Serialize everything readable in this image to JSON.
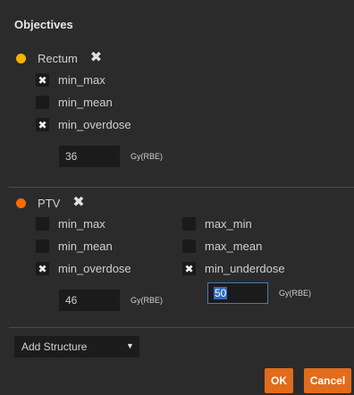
{
  "title": "Objectives",
  "colors": {
    "rectum_dot": "#f5b400",
    "ptv_dot": "#ff6a00",
    "button": "#e06c1c",
    "checkmark": "✖"
  },
  "structures": [
    {
      "name": "Rectum",
      "objectives": [
        {
          "label": "min_max",
          "checked": true
        },
        {
          "label": "min_mean",
          "checked": false
        },
        {
          "label": "min_overdose",
          "checked": true
        }
      ],
      "dose": {
        "value": "36",
        "unit": "Gy(RBE)"
      }
    },
    {
      "name": "PTV",
      "objectives_left": [
        {
          "label": "min_max",
          "checked": false
        },
        {
          "label": "min_mean",
          "checked": false
        },
        {
          "label": "min_overdose",
          "checked": true
        }
      ],
      "objectives_right": [
        {
          "label": "max_min",
          "checked": false
        },
        {
          "label": "max_mean",
          "checked": false
        },
        {
          "label": "min_underdose",
          "checked": true
        }
      ],
      "overdose_dose": {
        "value": "46",
        "unit": "Gy(RBE)"
      },
      "underdose_dose": {
        "value": "50",
        "unit": "Gy(RBE)"
      }
    }
  ],
  "add_structure": {
    "label": "Add Structure",
    "arrow": "▼"
  },
  "buttons": {
    "ok": "OK",
    "cancel": "Cancel"
  }
}
